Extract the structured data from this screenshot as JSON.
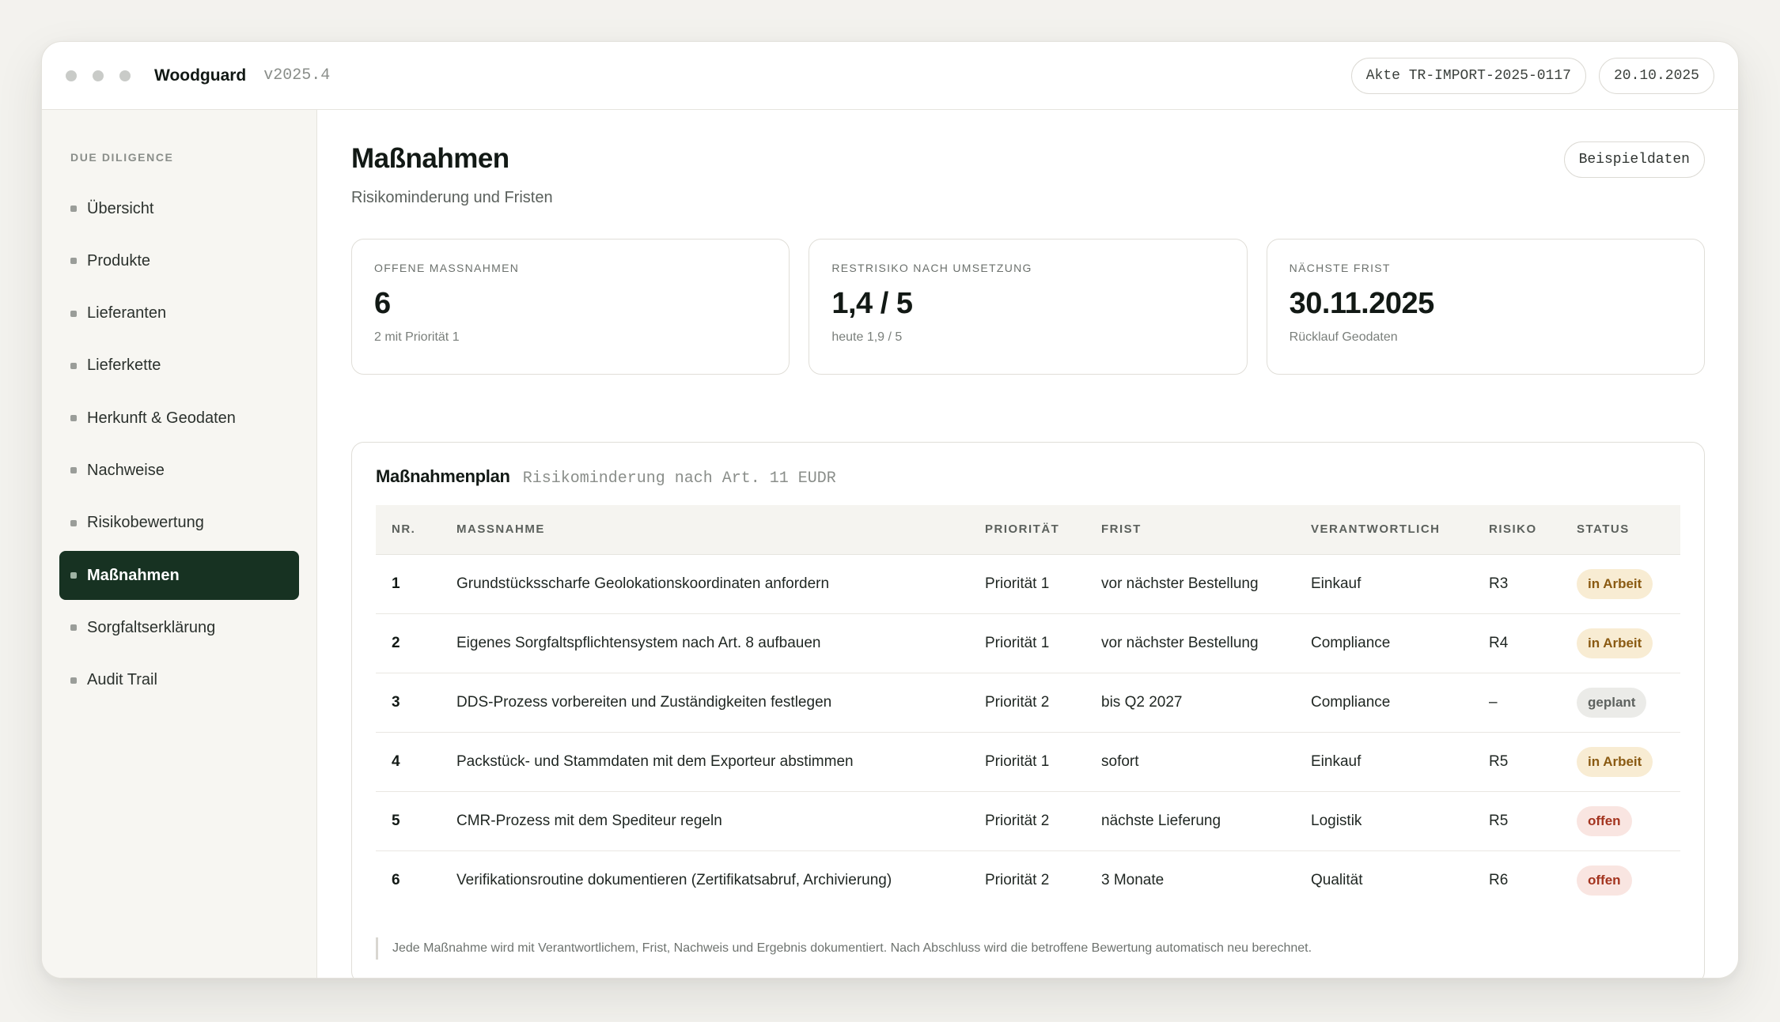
{
  "app": {
    "name": "Woodguard",
    "version": "v2025.4",
    "file_ref": "Akte TR-IMPORT-2025-0117",
    "date": "20.10.2025"
  },
  "sidebar": {
    "section": "DUE DILIGENCE",
    "items": [
      {
        "label": "Übersicht",
        "active": false
      },
      {
        "label": "Produkte",
        "active": false
      },
      {
        "label": "Lieferanten",
        "active": false
      },
      {
        "label": "Lieferkette",
        "active": false
      },
      {
        "label": "Herkunft & Geodaten",
        "active": false
      },
      {
        "label": "Nachweise",
        "active": false
      },
      {
        "label": "Risikobewertung",
        "active": false
      },
      {
        "label": "Maßnahmen",
        "active": true
      },
      {
        "label": "Sorgfaltserklärung",
        "active": false
      },
      {
        "label": "Audit Trail",
        "active": false
      }
    ]
  },
  "page": {
    "title": "Maßnahmen",
    "subtitle": "Risikominderung und Fristen",
    "sample_button": "Beispieldaten"
  },
  "cards": [
    {
      "label": "OFFENE MASSNAHMEN",
      "value": "6",
      "sub": "2 mit Priorität 1"
    },
    {
      "label": "RESTRISIKO NACH UMSETZUNG",
      "value": "1,4 / 5",
      "sub": "heute 1,9 / 5"
    },
    {
      "label": "NÄCHSTE FRIST",
      "value": "30.11.2025",
      "sub": "Rücklauf Geodaten"
    }
  ],
  "plan": {
    "title": "Maßnahmenplan",
    "subtitle": "Risikominderung nach Art. 11 EUDR",
    "columns": [
      "NR.",
      "MASSNAHME",
      "PRIORITÄT",
      "FRIST",
      "VERANTWORTLICH",
      "RISIKO",
      "STATUS"
    ],
    "rows": [
      {
        "nr": "1",
        "measure": "Grundstücksscharfe Geolokationskoordinaten anfordern",
        "priority": "Priorität 1",
        "deadline": "vor nächster Bestellung",
        "owner": "Einkauf",
        "risk": "R3",
        "status": "in Arbeit",
        "status_kind": "arbeit"
      },
      {
        "nr": "2",
        "measure": "Eigenes Sorgfaltspflichtensystem nach Art. 8 aufbauen",
        "priority": "Priorität 1",
        "deadline": "vor nächster Bestellung",
        "owner": "Compliance",
        "risk": "R4",
        "status": "in Arbeit",
        "status_kind": "arbeit"
      },
      {
        "nr": "3",
        "measure": "DDS-Prozess vorbereiten und Zuständigkeiten festlegen",
        "priority": "Priorität 2",
        "deadline": "bis Q2 2027",
        "owner": "Compliance",
        "risk": "–",
        "status": "geplant",
        "status_kind": "geplant"
      },
      {
        "nr": "4",
        "measure": "Packstück- und Stammdaten mit dem Exporteur abstimmen",
        "priority": "Priorität 1",
        "deadline": "sofort",
        "owner": "Einkauf",
        "risk": "R5",
        "status": "in Arbeit",
        "status_kind": "arbeit"
      },
      {
        "nr": "5",
        "measure": "CMR-Prozess mit dem Spediteur regeln",
        "priority": "Priorität 2",
        "deadline": "nächste Lieferung",
        "owner": "Logistik",
        "risk": "R5",
        "status": "offen",
        "status_kind": "offen"
      },
      {
        "nr": "6",
        "measure": "Verifikationsroutine dokumentieren (Zertifikatsabruf, Archivierung)",
        "priority": "Priorität 2",
        "deadline": "3 Monate",
        "owner": "Qualität",
        "risk": "R6",
        "status": "offen",
        "status_kind": "offen"
      }
    ],
    "note": "Jede Maßnahme wird mit Verantwortlichem, Frist, Nachweis und Ergebnis dokumentiert. Nach Abschluss wird die betroffene Bewertung automatisch neu berechnet."
  },
  "colors": {
    "accent": "#173222",
    "status_in_progress": "#f8ecd3",
    "status_planned": "#ebebe8",
    "status_open": "#f9e5e1"
  }
}
